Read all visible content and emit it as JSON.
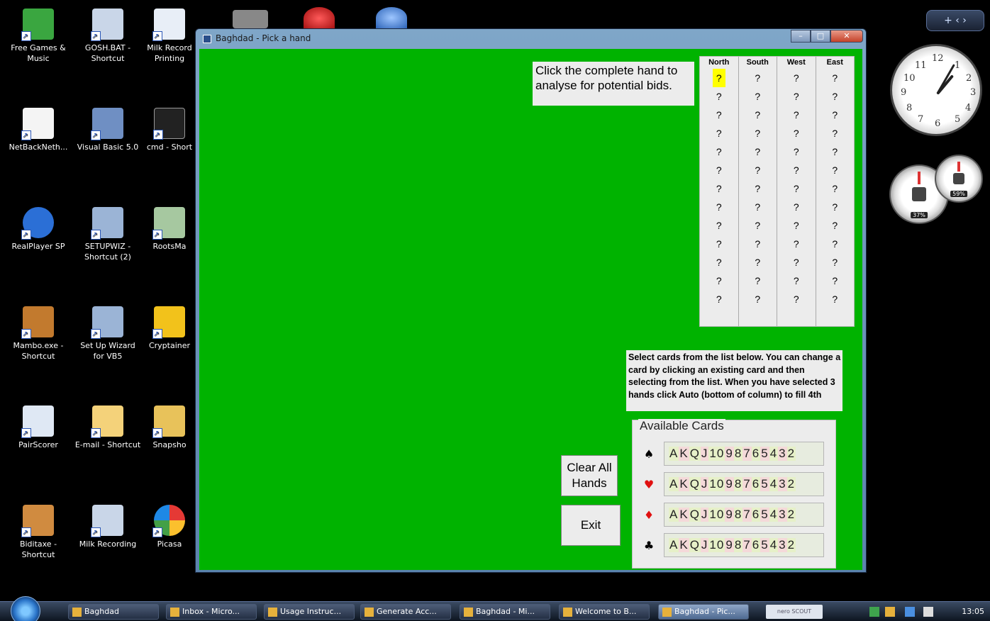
{
  "desktop": {
    "icons": [
      {
        "label": "Free Games & Music"
      },
      {
        "label": "GOSH.BAT - Shortcut"
      },
      {
        "label": "Milk Record Printing"
      },
      {
        "label": "NetBackNeth..."
      },
      {
        "label": "Visual Basic 5.0"
      },
      {
        "label": "cmd - Short"
      },
      {
        "label": "RealPlayer SP"
      },
      {
        "label": "SETUPWIZ - Shortcut (2)"
      },
      {
        "label": "RootsMa"
      },
      {
        "label": "Mambo.exe - Shortcut"
      },
      {
        "label": "Set Up Wizard for VB5"
      },
      {
        "label": "Cryptainer"
      },
      {
        "label": "PairScorer"
      },
      {
        "label": "E-mail - Shortcut"
      },
      {
        "label": "Snapsho"
      },
      {
        "label": "Biditaxe - Shortcut"
      },
      {
        "label": "Milk Recording"
      },
      {
        "label": "Picasa"
      }
    ]
  },
  "gadgets": {
    "bar_symbols": "+ ‹ ›",
    "clock_numbers": [
      "12",
      "1",
      "2",
      "3",
      "4",
      "5",
      "6",
      "7",
      "8",
      "9",
      "10",
      "11"
    ],
    "cpu_pct": "37%",
    "mem_pct": "59%"
  },
  "window": {
    "title": "Baghdad - Pick a hand",
    "min": "–",
    "max": "□",
    "close": "✕"
  },
  "instructions": {
    "top": "Click the complete hand to analyse for potential bids.",
    "bottom": "Select cards from the list below. You can change a card by clicking an existing card and then selecting from the list. When you have selected 3 hands click Auto (bottom of column) to fill 4th"
  },
  "hands": {
    "columns": [
      "North",
      "South",
      "West",
      "East"
    ],
    "cell": "?",
    "rows": 13
  },
  "available": {
    "legend": "Available Cards",
    "suits": [
      {
        "symbol": "♠",
        "color": "#000000",
        "cards": [
          "A",
          "K",
          "Q",
          "J",
          "10",
          "9",
          "8",
          "7",
          "6",
          "5",
          "4",
          "3",
          "2"
        ]
      },
      {
        "symbol": "♥",
        "color": "#e01010",
        "cards": [
          "A",
          "K",
          "Q",
          "J",
          "10",
          "9",
          "8",
          "7",
          "6",
          "5",
          "4",
          "3",
          "2"
        ]
      },
      {
        "symbol": "♦",
        "color": "#e01010",
        "cards": [
          "A",
          "K",
          "Q",
          "J",
          "10",
          "9",
          "8",
          "7",
          "6",
          "5",
          "4",
          "3",
          "2"
        ]
      },
      {
        "symbol": "♣",
        "color": "#000000",
        "cards": [
          "A",
          "K",
          "Q",
          "J",
          "10",
          "9",
          "8",
          "7",
          "6",
          "5",
          "4",
          "3",
          "2"
        ]
      }
    ]
  },
  "buttons": {
    "clear": "Clear All Hands",
    "exit": "Exit"
  },
  "taskbar": {
    "tasks": [
      {
        "label": "Baghdad",
        "active": false
      },
      {
        "label": "Inbox - Micro...",
        "active": false
      },
      {
        "label": "Usage Instruc...",
        "active": false
      },
      {
        "label": "Generate Acc...",
        "active": false
      },
      {
        "label": "Baghdad - Mi...",
        "active": false
      },
      {
        "label": "Welcome to B...",
        "active": false
      },
      {
        "label": "Baghdad - Pic...",
        "active": true
      }
    ],
    "nero_label": "nero SCOUT",
    "clock": "13:05"
  }
}
